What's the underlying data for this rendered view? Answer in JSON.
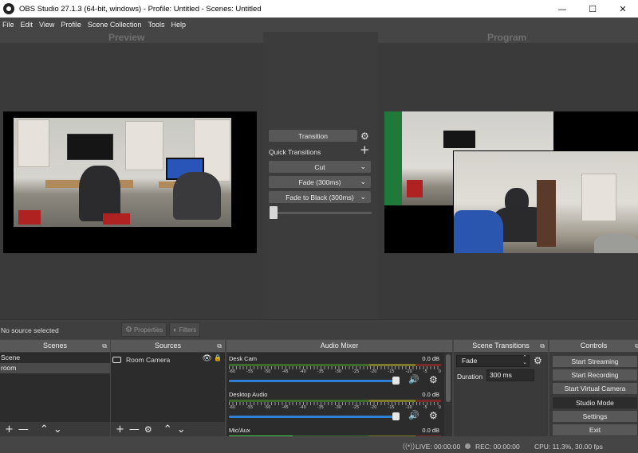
{
  "window": {
    "title": "OBS Studio 27.1.3 (64-bit, windows) - Profile: Untitled - Scenes: Untitled",
    "minimize": "—",
    "maximize": "☐",
    "close": "✕"
  },
  "menu": [
    "File",
    "Edit",
    "View",
    "Profile",
    "Scene Collection",
    "Tools",
    "Help"
  ],
  "panes": {
    "preview": "Preview",
    "program": "Program"
  },
  "transition_panel": {
    "transition_button": "Transition",
    "quick_transitions_label": "Quick Transitions",
    "add_icon": "+",
    "quick": [
      "Cut",
      "Fade (300ms)",
      "Fade to Black (300ms)"
    ]
  },
  "source_toolbar": {
    "no_source": "No source selected",
    "properties": "Properties",
    "filters": "Filters"
  },
  "scenes": {
    "title": "Scenes",
    "items": [
      "Scene",
      "room"
    ],
    "selected_index": 1
  },
  "sources": {
    "title": "Sources",
    "items": [
      "Room Camera"
    ]
  },
  "audio_mixer": {
    "title": "Audio Mixer",
    "scale": [
      "-60",
      "-55",
      "-50",
      "-45",
      "-40",
      "-35",
      "-30",
      "-25",
      "-20",
      "-15",
      "-10",
      "-5",
      "0"
    ],
    "channels": [
      {
        "name": "Desk Cam",
        "db": "0.0 dB",
        "volume": 1.0
      },
      {
        "name": "Desktop Audio",
        "db": "0.0 dB",
        "volume": 1.0
      },
      {
        "name": "Mic/Aux",
        "db": "0.0 dB",
        "volume": 1.0
      }
    ]
  },
  "scene_transitions": {
    "title": "Scene Transitions",
    "selected": "Fade",
    "duration_label": "Duration",
    "duration_value": "300 ms"
  },
  "controls": {
    "title": "Controls",
    "buttons": [
      "Start Streaming",
      "Start Recording",
      "Start Virtual Camera",
      "Studio Mode",
      "Settings",
      "Exit"
    ],
    "active_index": 3
  },
  "status": {
    "live": "LIVE: 00:00:00",
    "rec": "REC: 00:00:00",
    "cpu": "CPU: 11.3%, 30.00 fps"
  },
  "colors": {
    "fader": "#2f7fd6",
    "dock_header": "#585858",
    "background": "#454545"
  }
}
